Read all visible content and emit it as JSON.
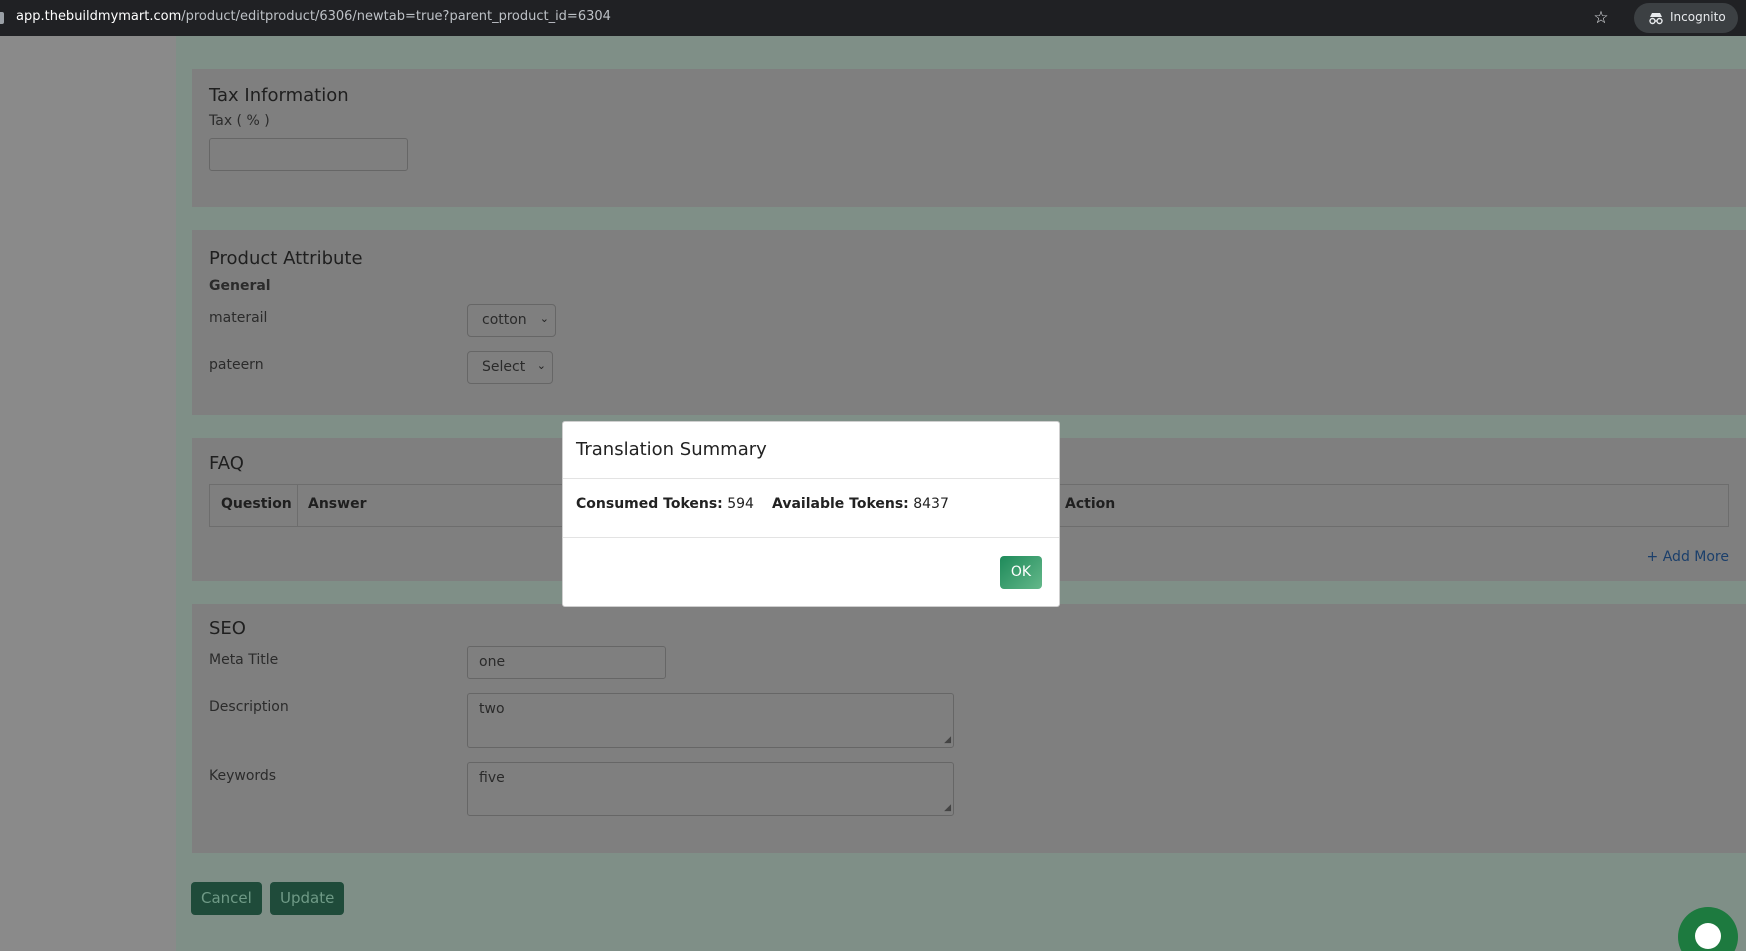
{
  "browser": {
    "url_domain": "app.thebuildmymart.com",
    "url_path": "/product/editproduct/6306/newtab=true?parent_product_id=6304",
    "star_icon": "☆",
    "incognito_label": "Incognito"
  },
  "tax": {
    "title": "Tax Information",
    "field_label": "Tax ( % )",
    "value": ""
  },
  "attributes": {
    "title": "Product Attribute",
    "group": "General",
    "rows": [
      {
        "label": "materail",
        "selected": "cotton"
      },
      {
        "label": "pateern",
        "selected": "Select"
      }
    ]
  },
  "faq": {
    "title": "FAQ",
    "columns": {
      "question": "Question",
      "answer": "Answer",
      "action": "Action"
    },
    "add_more": "+ Add More"
  },
  "seo": {
    "title": "SEO",
    "meta_title_label": "Meta Title",
    "meta_title_value": "one",
    "description_label": "Description",
    "description_value": "two",
    "keywords_label": "Keywords",
    "keywords_value": "five"
  },
  "actions": {
    "cancel": "Cancel",
    "update": "Update"
  },
  "modal": {
    "title": "Translation Summary",
    "consumed_label": "Consumed Tokens:",
    "consumed_value": "594",
    "available_label": "Available Tokens:",
    "available_value": "8437",
    "ok": "OK"
  },
  "colors": {
    "accent": "#2a8c5e",
    "overlay": "#7f7f7f"
  }
}
